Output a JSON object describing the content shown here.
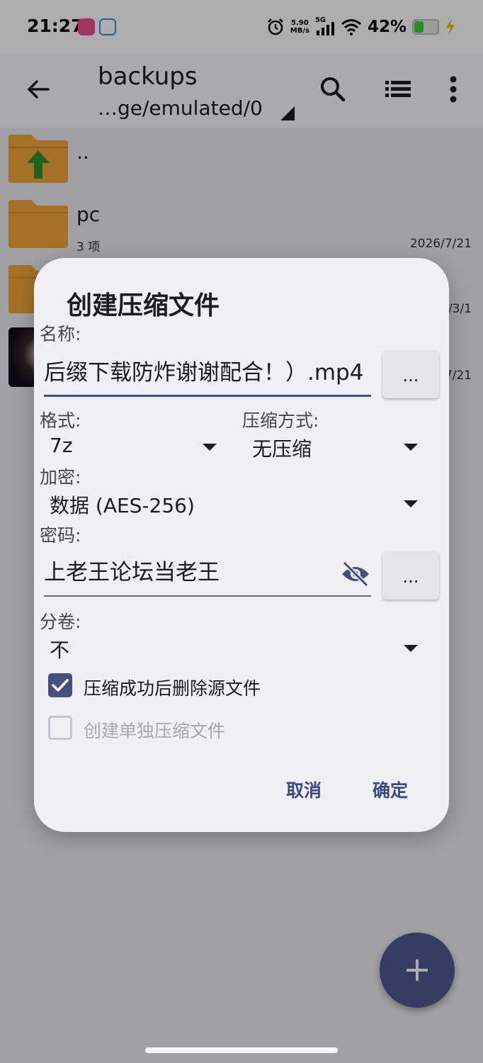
{
  "status_bar": {
    "time": "21:27",
    "net_speed_value": "5.90",
    "net_speed_unit": "MB/s",
    "network": "5G",
    "battery_percent": "42%",
    "battery_level": 0.42,
    "battery_color": "#3ad33a"
  },
  "toolbar": {
    "title": "backups",
    "path": "…ge/emulated/0",
    "icons": [
      "back-arrow-icon",
      "search-icon",
      "list-view-icon",
      "more-vert-icon"
    ]
  },
  "file_list": [
    {
      "name": "..",
      "icon": "folder-up-icon"
    },
    {
      "name": "pc",
      "count": "3 项",
      "date": "2026/7/21",
      "icon": "folder-icon"
    },
    {
      "date_partial": "/3/1",
      "icon": "folder-icon"
    },
    {
      "date_partial": "7/21",
      "icon": "image-thumbnail"
    }
  ],
  "dialog": {
    "title": "创建压缩文件",
    "name_label": "名称:",
    "name_value": "后缀下载防炸谢谢配合！）.mp4",
    "browse_label": "...",
    "format_label": "格式:",
    "format_value": "7z",
    "compression_label": "压缩方式:",
    "compression_value": "无压缩",
    "encryption_label": "加密:",
    "encryption_value": "数据 (AES-256)",
    "password_label": "密码:",
    "password_value": "上老王论坛当老王",
    "password_more_label": "...",
    "split_label": "分卷:",
    "split_value": "不",
    "delete_source_label": "压缩成功后删除源文件",
    "delete_source_checked": true,
    "separate_archives_label": "创建单独压缩文件",
    "separate_archives_checked": false,
    "cancel_label": "取消",
    "ok_label": "确定"
  },
  "colors": {
    "accent": "#44507f",
    "folder": "#f0a83a",
    "fab": "#4e5b92"
  }
}
